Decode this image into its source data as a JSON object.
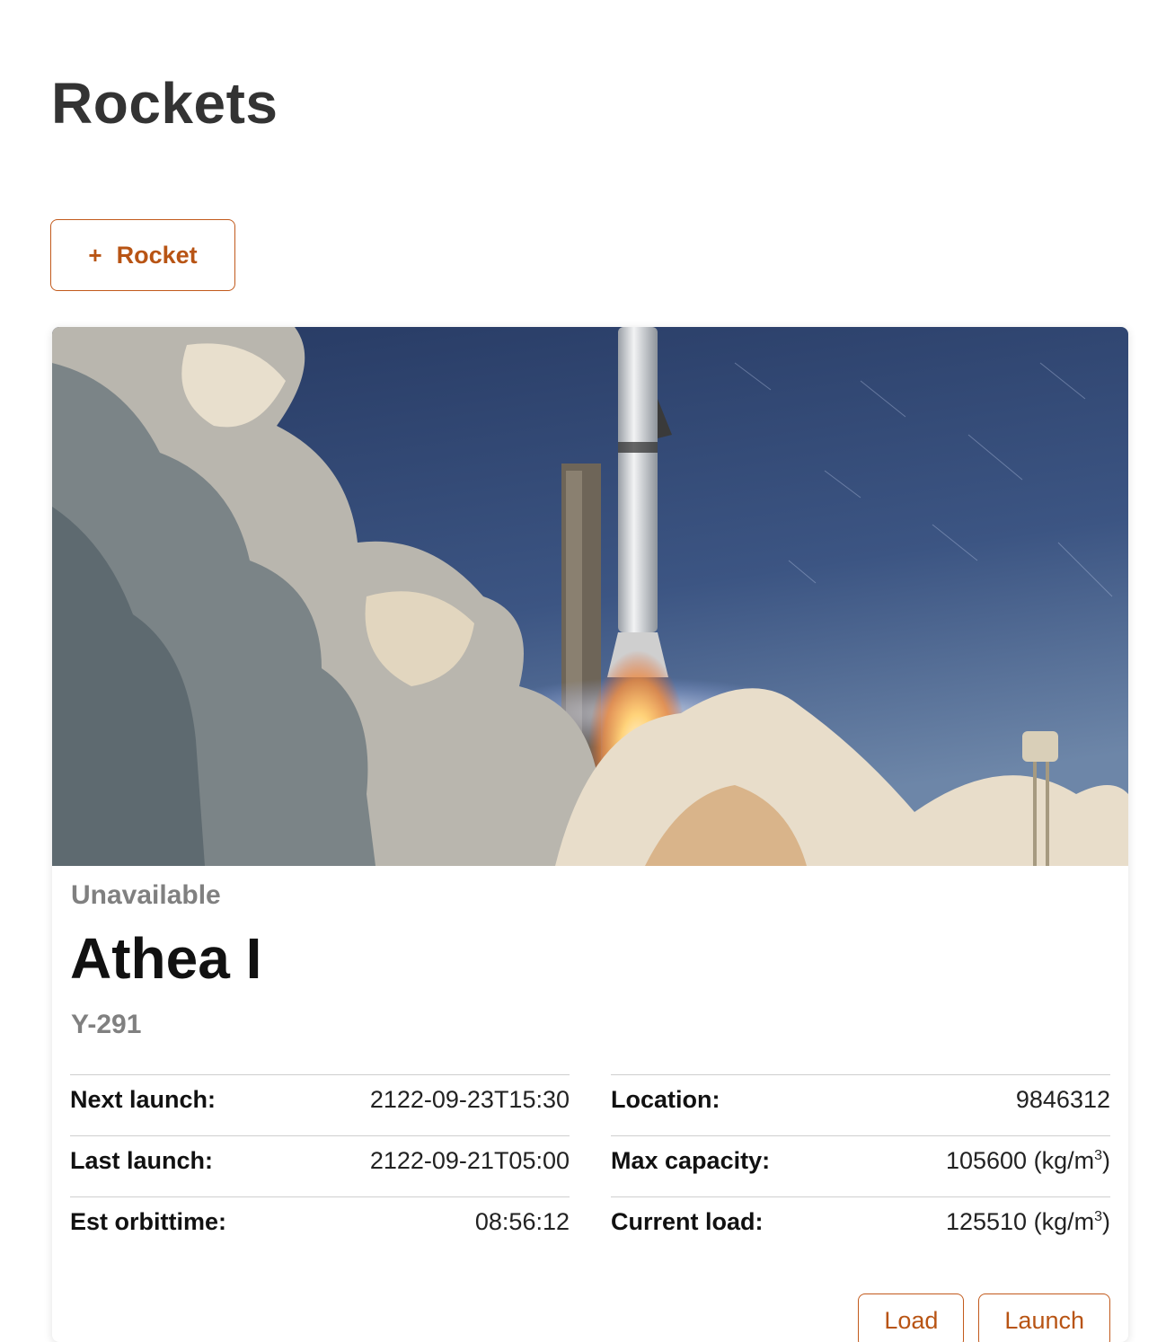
{
  "page": {
    "title": "Rockets"
  },
  "toolbar": {
    "add_icon": "+",
    "add_label": "Rocket"
  },
  "rocket": {
    "status": "Unavailable",
    "name": "Athea I",
    "serial": "Y-291",
    "details_left": [
      {
        "label": "Next launch:",
        "value": "2122-09-23T15:30"
      },
      {
        "label": "Last launch:",
        "value": "2122-09-21T05:00"
      },
      {
        "label": "Est orbittime:",
        "value": "08:56:12"
      }
    ],
    "details_right": [
      {
        "label": "Location:",
        "value": "9846312",
        "unit": ""
      },
      {
        "label": "Max capacity:",
        "value": "105600",
        "unit": "(kg/m",
        "unit_sup": "3",
        "unit_close": ")"
      },
      {
        "label": "Current load:",
        "value": "125510",
        "unit": "(kg/m",
        "unit_sup": "3",
        "unit_close": ")"
      }
    ],
    "actions": {
      "load": "Load",
      "launch": "Launch"
    }
  },
  "colors": {
    "accent": "#b85414",
    "muted": "#808080",
    "sky": "#2c3e66"
  }
}
